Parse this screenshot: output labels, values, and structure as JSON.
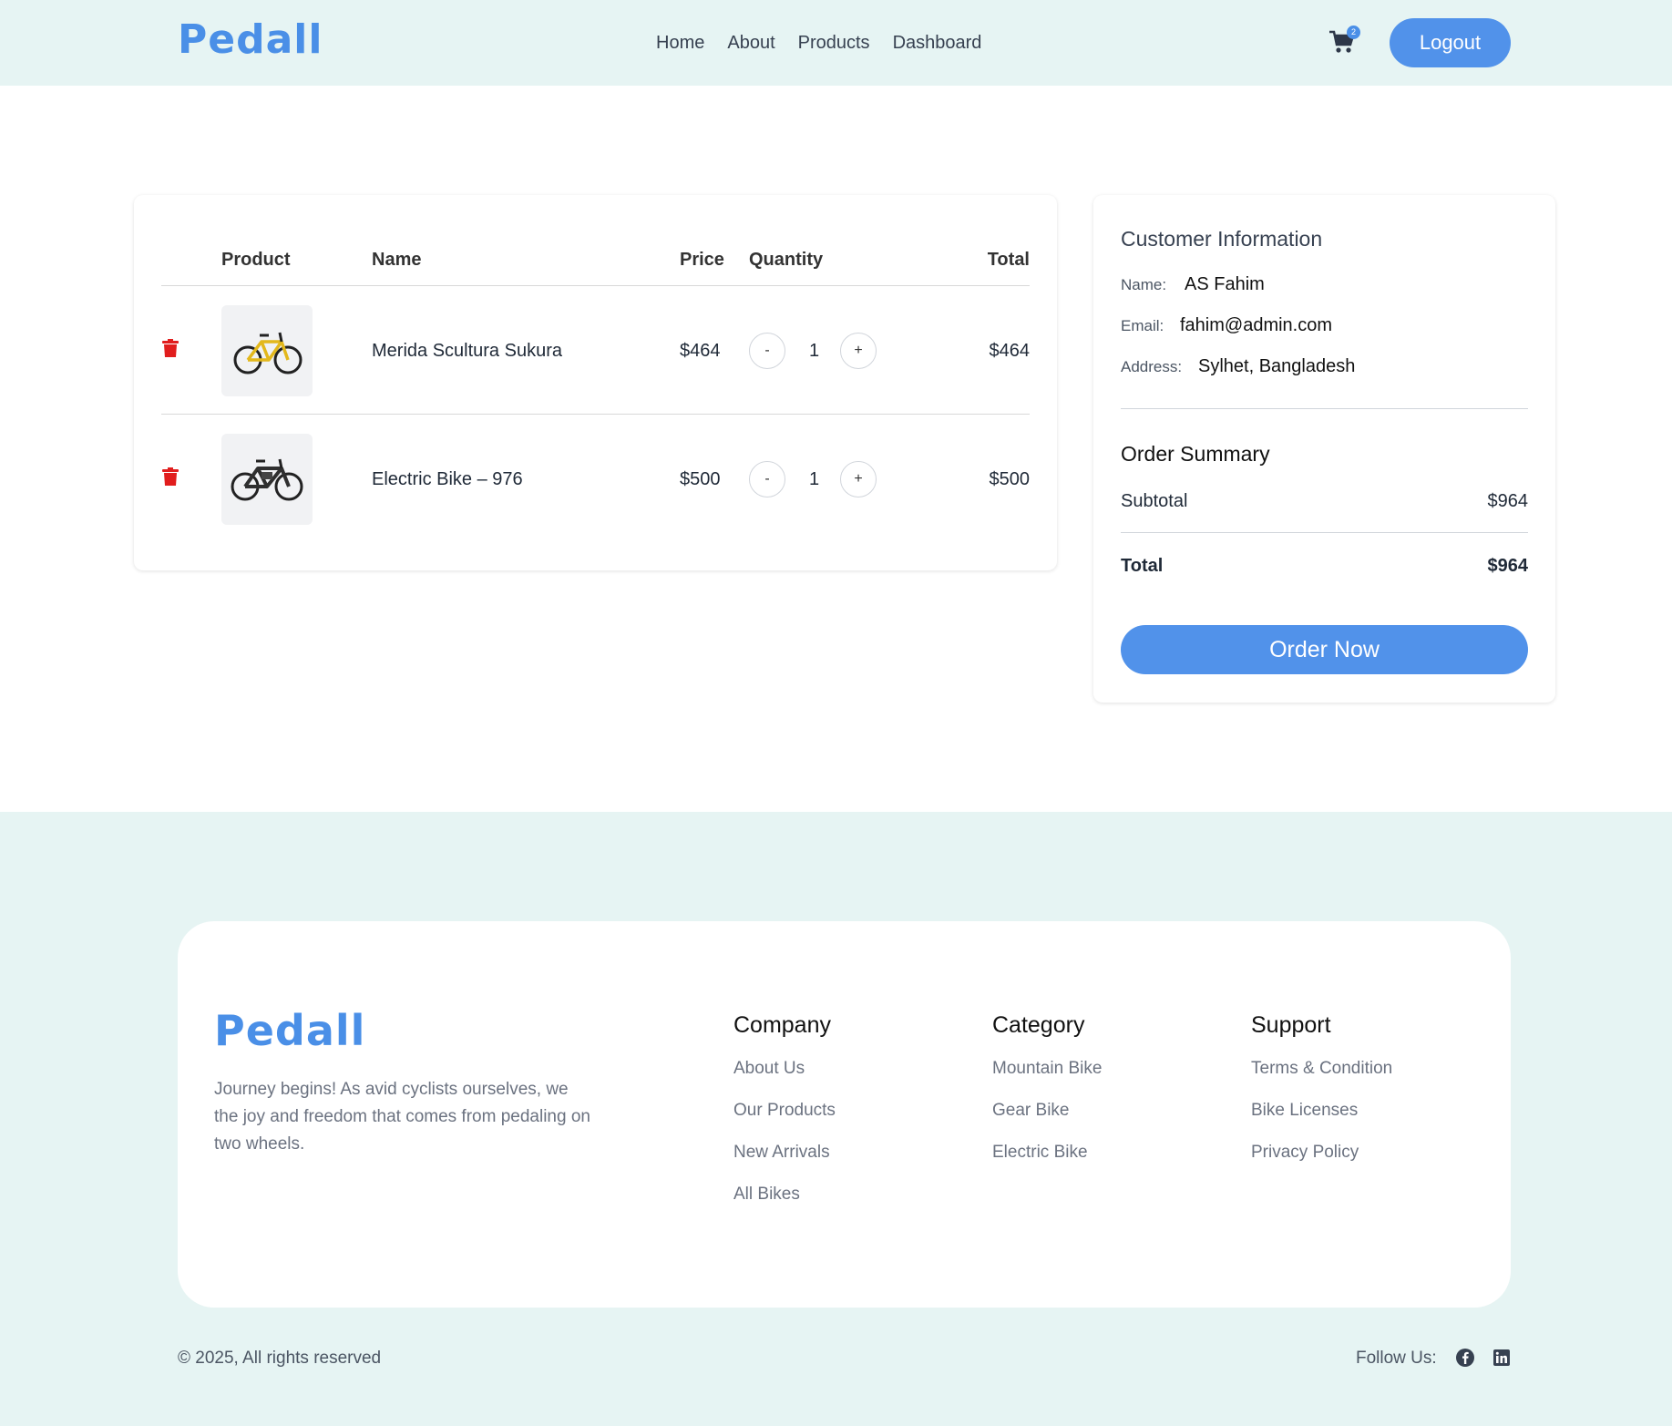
{
  "header": {
    "logo": "Pedall",
    "nav": [
      "Home",
      "About",
      "Products",
      "Dashboard"
    ],
    "cart_count": "2",
    "logout_label": "Logout"
  },
  "cart": {
    "columns": {
      "product": "Product",
      "name": "Name",
      "price": "Price",
      "quantity": "Quantity",
      "total": "Total"
    },
    "items": [
      {
        "name": "Merida Scultura Sukura",
        "price": "$464",
        "qty": "1",
        "total": "$464",
        "minus": "-",
        "plus": "+",
        "frame_color": "#e3b81c"
      },
      {
        "name": "Electric Bike – 976",
        "price": "$500",
        "qty": "1",
        "total": "$500",
        "minus": "-",
        "plus": "+",
        "frame_color": "#2f2f2f"
      }
    ]
  },
  "customer": {
    "title": "Customer Information",
    "name_label": "Name:",
    "name": "AS Fahim",
    "email_label": "Email:",
    "email": "fahim@admin.com",
    "address_label": "Address:",
    "address": "Sylhet, Bangladesh"
  },
  "summary": {
    "title": "Order Summary",
    "subtotal_label": "Subtotal",
    "subtotal": "$964",
    "total_label": "Total",
    "total": "$964",
    "order_label": "Order Now"
  },
  "footer": {
    "logo": "Pedall",
    "about": "Journey begins! As avid cyclists ourselves, we the joy and freedom that comes from pedaling on two wheels.",
    "columns": [
      {
        "title": "Company",
        "links": [
          "About Us",
          "Our Products",
          "New Arrivals",
          "All Bikes"
        ]
      },
      {
        "title": "Category",
        "links": [
          "Mountain Bike",
          "Gear Bike",
          "Electric Bike"
        ]
      },
      {
        "title": "Support",
        "links": [
          "Terms & Condition",
          "Bike Licenses",
          "Privacy Policy"
        ]
      }
    ],
    "copyright": "© 2025, All rights reserved",
    "follow": "Follow Us:",
    "social_icons": [
      "facebook-icon",
      "linkedin-icon"
    ]
  },
  "colors": {
    "accent": "#5192ea",
    "header_bg": "#e6f4f3",
    "danger": "#e11d1d"
  }
}
